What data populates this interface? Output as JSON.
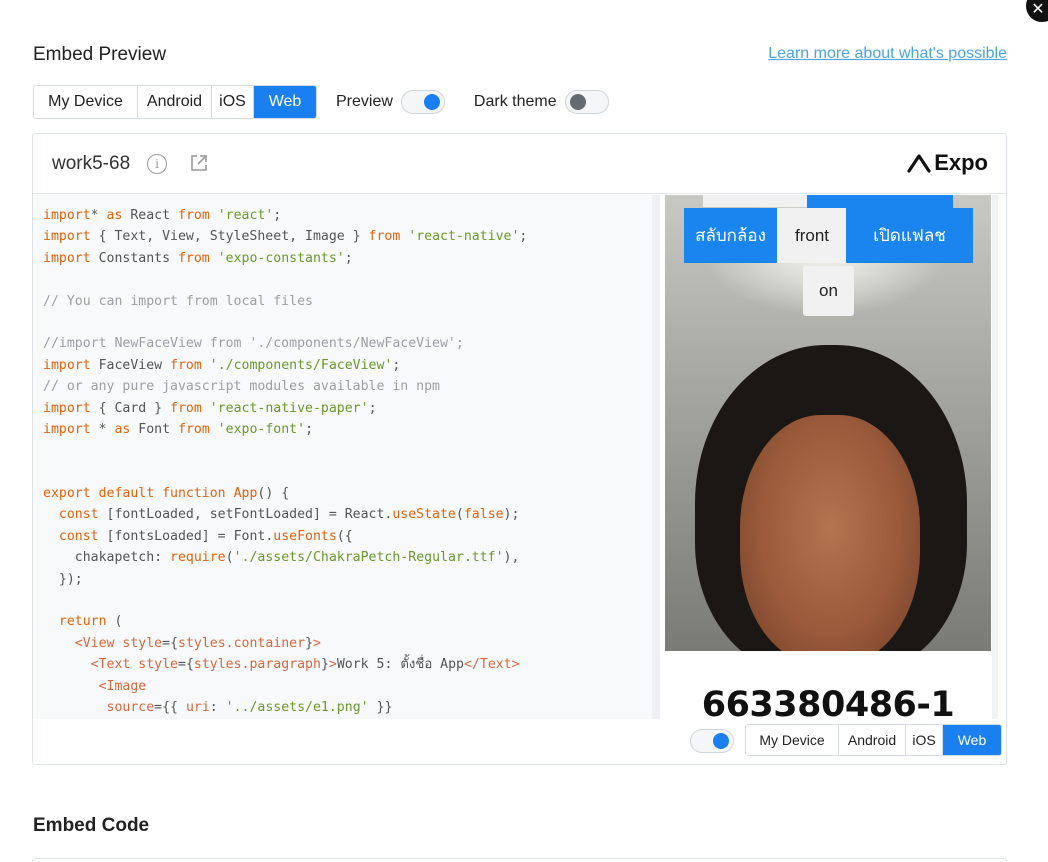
{
  "header": {
    "title": "Embed Preview",
    "learn_link": "Learn more about what's possible"
  },
  "platforms": [
    "My Device",
    "Android",
    "iOS",
    "Web"
  ],
  "selected_platform": "Web",
  "preview": {
    "label": "Preview",
    "on": true
  },
  "dark_theme": {
    "label": "Dark theme",
    "on": false
  },
  "snack": {
    "name": "work5-68",
    "brand": "Expo"
  },
  "code_lines": [
    [
      [
        "kw",
        "import"
      ],
      [
        "",
        "* "
      ],
      [
        "kw",
        "as"
      ],
      [
        "",
        " React "
      ],
      [
        "kw",
        "from"
      ],
      [
        "",
        " "
      ],
      [
        "str",
        "'react'"
      ],
      [
        "",
        ";"
      ]
    ],
    [
      [
        "kw",
        "import"
      ],
      [
        "",
        " { Text, View, StyleSheet, Image } "
      ],
      [
        "kw",
        "from"
      ],
      [
        "",
        " "
      ],
      [
        "str",
        "'react-native'"
      ],
      [
        "",
        ";"
      ]
    ],
    [
      [
        "kw",
        "import"
      ],
      [
        "",
        " Constants "
      ],
      [
        "kw",
        "from"
      ],
      [
        "",
        " "
      ],
      [
        "str",
        "'expo-constants'"
      ],
      [
        "",
        ";"
      ]
    ],
    [],
    [
      [
        "cm",
        "// You can import from local files"
      ]
    ],
    [],
    [
      [
        "cm",
        "//import NewFaceView from './components/NewFaceView';"
      ]
    ],
    [
      [
        "kw",
        "import"
      ],
      [
        "",
        " FaceView "
      ],
      [
        "kw",
        "from"
      ],
      [
        "",
        " "
      ],
      [
        "str",
        "'./components/FaceView'"
      ],
      [
        "",
        ";"
      ]
    ],
    [
      [
        "cm",
        "// or any pure javascript modules available in npm"
      ]
    ],
    [
      [
        "kw",
        "import"
      ],
      [
        "",
        " { Card } "
      ],
      [
        "kw",
        "from"
      ],
      [
        "",
        " "
      ],
      [
        "str",
        "'react-native-paper'"
      ],
      [
        "",
        ";"
      ]
    ],
    [
      [
        "kw",
        "import"
      ],
      [
        "",
        " * "
      ],
      [
        "kw",
        "as"
      ],
      [
        "",
        " Font "
      ],
      [
        "kw",
        "from"
      ],
      [
        "",
        " "
      ],
      [
        "str",
        "'expo-font'"
      ],
      [
        "",
        ";"
      ]
    ],
    [],
    [],
    [
      [
        "kw",
        "export default function"
      ],
      [
        "",
        " "
      ],
      [
        "fn",
        "App"
      ],
      [
        "",
        "() {"
      ]
    ],
    [
      [
        "",
        "  "
      ],
      [
        "kw",
        "const"
      ],
      [
        "",
        " [fontLoaded, setFontLoaded] = React."
      ],
      [
        "fn",
        "useState"
      ],
      [
        "",
        "("
      ],
      [
        "kw",
        "false"
      ],
      [
        "",
        ");"
      ]
    ],
    [
      [
        "",
        "  "
      ],
      [
        "kw",
        "const"
      ],
      [
        "",
        " [fontsLoaded] = Font."
      ],
      [
        "fn",
        "useFonts"
      ],
      [
        "",
        "({"
      ]
    ],
    [
      [
        "",
        "    chakapetch: "
      ],
      [
        "fn",
        "require"
      ],
      [
        "",
        "("
      ],
      [
        "str",
        "'./assets/ChakraPetch-Regular.ttf'"
      ],
      [
        "",
        "),"
      ]
    ],
    [
      [
        "",
        "  });"
      ]
    ],
    [],
    [
      [
        "",
        "  "
      ],
      [
        "kw",
        "return"
      ],
      [
        "",
        " ("
      ]
    ],
    [
      [
        "",
        "    "
      ],
      [
        "tag",
        "<View"
      ],
      [
        "",
        " "
      ],
      [
        "attr",
        "style"
      ],
      [
        "",
        "={"
      ],
      [
        "attr",
        "styles.container"
      ],
      [
        "",
        "}"
      ],
      [
        "tag",
        ">"
      ]
    ],
    [
      [
        "",
        "      "
      ],
      [
        "tag",
        "<Text"
      ],
      [
        "",
        " "
      ],
      [
        "attr",
        "style"
      ],
      [
        "",
        "={"
      ],
      [
        "attr",
        "styles.paragraph"
      ],
      [
        "",
        "}"
      ],
      [
        "tag",
        ">"
      ],
      [
        "",
        "Work 5: ตั้งชื่อ App"
      ],
      [
        "tag",
        "</Text"
      ],
      [
        "tag",
        ">"
      ]
    ],
    [
      [
        "",
        "       "
      ],
      [
        "tag",
        "<Image"
      ]
    ],
    [
      [
        "",
        "        "
      ],
      [
        "attr",
        "source"
      ],
      [
        "",
        "={{ "
      ],
      [
        "attr",
        "uri"
      ],
      [
        "",
        ": "
      ],
      [
        "str",
        "'../assets/e1.png'"
      ],
      [
        "",
        " }}"
      ]
    ]
  ],
  "app_preview": {
    "switch_camera": "สลับกล้อง",
    "camera_side": "front",
    "flash": "เปิดแฟลช",
    "flash_state": "on",
    "student_id": "663380486-1"
  },
  "bottom": {
    "platforms": [
      "My Device",
      "Android",
      "iOS",
      "Web"
    ],
    "selected": "Web"
  },
  "embed_code": {
    "title": "Embed Code"
  },
  "colors": {
    "accent": "#1a80ef",
    "link": "#4aa3df"
  }
}
